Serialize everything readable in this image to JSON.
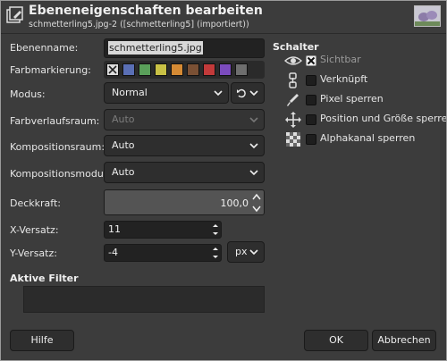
{
  "window": {
    "title": "Ebeneneigenschaften bearbeiten",
    "subtitle": "schmetterling5.jpg-2 ([schmetterling5] (importiert))"
  },
  "form": {
    "layer_name_label": "Ebenenname:",
    "layer_name_value": "schmetterling5.jpg",
    "color_tag_label": "Farbmarkierung:",
    "color_tags": [
      "#dcdcdc",
      "#5a6fb5",
      "#5aa05a",
      "#c9c145",
      "#d58a34",
      "#7a5034",
      "#c23a3a",
      "#7b4bbd",
      "#6e6e6e"
    ],
    "mode_label": "Modus:",
    "mode_value": "Normal",
    "blend_space_label": "Farbverlaufsraum:",
    "blend_space_value": "Auto",
    "composite_space_label": "Kompositionsraum:",
    "composite_space_value": "Auto",
    "composite_mode_label": "Kompositionsmodus:",
    "composite_mode_value": "Auto",
    "opacity_label": "Deckkraft:",
    "opacity_value": "100,0",
    "x_offset_label": "X-Versatz:",
    "x_offset_value": "11",
    "y_offset_label": "Y-Versatz:",
    "y_offset_value": "-4",
    "unit_value": "px",
    "active_filters_title": "Aktive Filter"
  },
  "switches": {
    "title": "Schalter",
    "items": [
      {
        "label": "Sichtbar",
        "checked": true,
        "icon": "eye-icon"
      },
      {
        "label": "Verknüpft",
        "checked": false,
        "icon": "chain-icon"
      },
      {
        "label": "Pixel sperren",
        "checked": false,
        "icon": "brush-icon"
      },
      {
        "label": "Position und Größe sperren",
        "checked": false,
        "icon": "move-arrows-icon"
      },
      {
        "label": "Alphakanal sperren",
        "checked": false,
        "icon": "checkerboard-icon"
      }
    ]
  },
  "buttons": {
    "help": "Hilfe",
    "ok": "OK",
    "cancel": "Abbrechen"
  }
}
